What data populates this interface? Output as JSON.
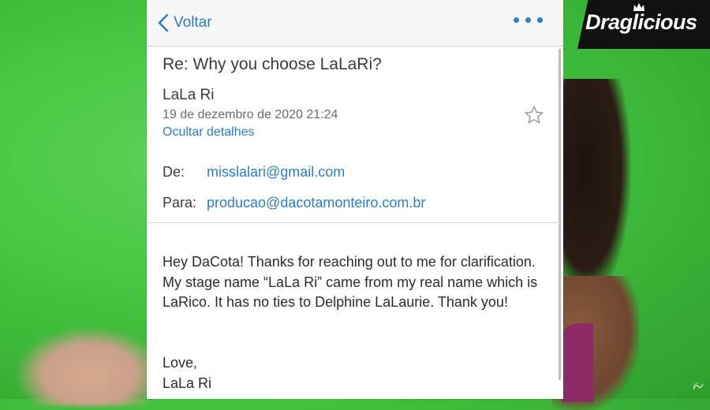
{
  "nav": {
    "back_label": "Voltar"
  },
  "email": {
    "subject": "Re: Why you choose LaLaRi?",
    "sender_name": "LaLa Ri",
    "date": "19 de dezembro de 2020 21:24",
    "hide_details_label": "Ocultar detalhes",
    "from_label": "De:",
    "from_value": "misslalari@gmail.com",
    "to_label": "Para:",
    "to_value": "producao@dacotamonteiro.com.br",
    "body": "Hey DaCota! Thanks for reaching out to me for clarification. My stage name “LaLa Ri” came from my real name which is LaRico. It has no ties to Delphine LaLaurie. Thank you!",
    "closing": "Love,",
    "signature": "LaLa Ri"
  },
  "logo": {
    "text": "Draglicious"
  },
  "colors": {
    "accent": "#2a7fc6",
    "background_green": "#43c23f"
  }
}
